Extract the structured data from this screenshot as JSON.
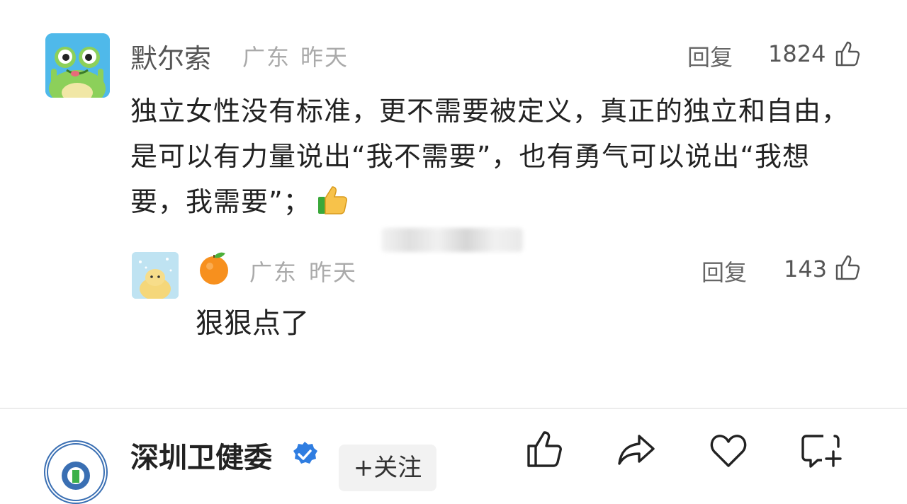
{
  "comment": {
    "author": "默尔索",
    "location": "广东",
    "time": "昨天",
    "reply_label": "回复",
    "like_count": "1824",
    "text": "独立女性没有标准，更不需要被定义，真正的独立和自由，是可以有力量说出“我不需要”，也有勇气可以说出“我想要，我需要”；"
  },
  "reply": {
    "author_emoji": "orange-emoji",
    "location": "广东",
    "time": "昨天",
    "reply_label": "回复",
    "like_count": "143",
    "text": "狠狠点了"
  },
  "bottom_bar": {
    "account_name": "深圳卫健委",
    "follow_label": "+关注",
    "subtitle": "",
    "verified_color": "#2f7de1"
  }
}
